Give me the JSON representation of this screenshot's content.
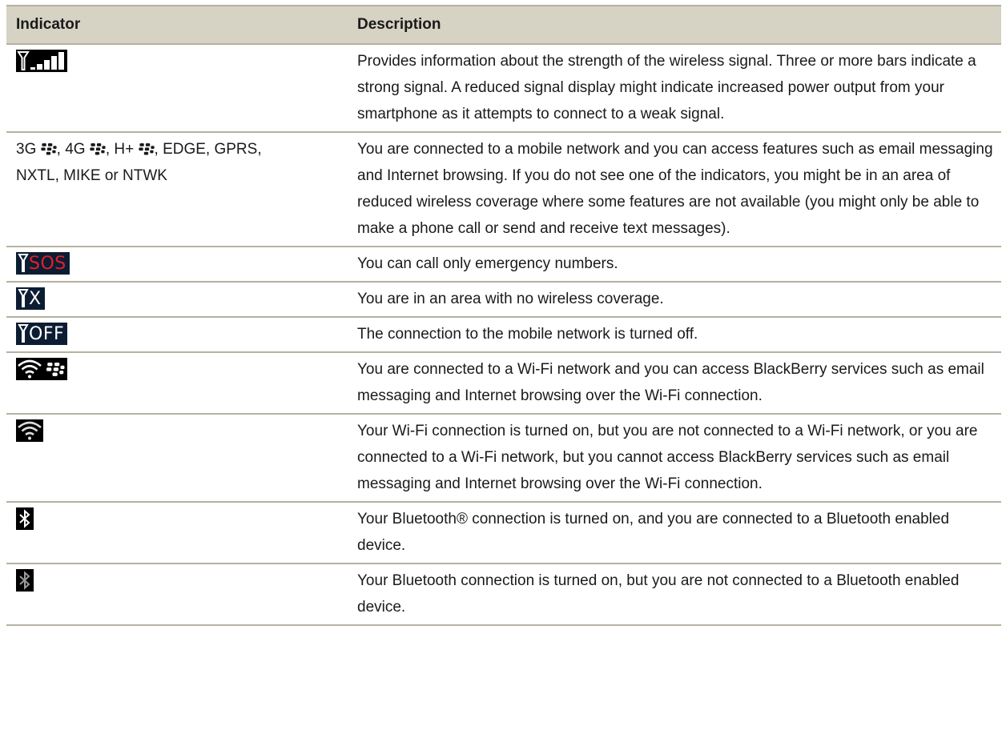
{
  "table": {
    "headers": {
      "indicator": "Indicator",
      "description": "Description"
    },
    "rows": [
      {
        "icon": "signal-strength-icon",
        "description": "Provides information about the strength of the wireless signal. Three or more bars indicate a strong signal. A reduced signal display might indicate increased power output from your smartphone as it attempts to connect to a weak signal."
      },
      {
        "indicator_text": {
          "g3": "3G",
          "g4": "4G",
          "hplus": "H+",
          "rest_line1": ", EDGE, GPRS,",
          "rest_line2": "NXTL, MIKE or NTWK"
        },
        "description": "You are connected to a mobile network and you can access features such as email messaging and Internet browsing. If you do not see one of the indicators, you might be in an area of reduced wireless coverage where some features are not available (you might only be able to make a phone call or send and receive text messages)."
      },
      {
        "icon": "sos-signal-icon",
        "icon_text": "SOS",
        "icon_text_color": "#e0202a",
        "description": "You can call only emergency numbers."
      },
      {
        "icon": "no-coverage-icon",
        "icon_text": "X",
        "icon_text_color": "#ffffff",
        "description": "You are in an area with no wireless coverage."
      },
      {
        "icon": "network-off-icon",
        "icon_text": "OFF",
        "icon_text_color": "#ffffff",
        "description": "The connection to the mobile network is turned off."
      },
      {
        "icon": "wifi-blackberry-icon",
        "description": "You are connected to a Wi-Fi network and you can access BlackBerry services such as email messaging and Internet browsing over the Wi-Fi connection."
      },
      {
        "icon": "wifi-icon",
        "description": "Your Wi-Fi connection is turned on, but you are not connected to a Wi-Fi network, or you are connected to a Wi-Fi network, but you cannot access BlackBerry services such as email messaging and Internet browsing over the Wi-Fi connection."
      },
      {
        "icon": "bluetooth-connected-icon",
        "description": "Your Bluetooth® connection is turned on, and you are connected to a Bluetooth enabled device."
      },
      {
        "icon": "bluetooth-on-icon",
        "description": "Your Bluetooth connection is turned on, but you are not connected to a Bluetooth enabled device."
      }
    ]
  },
  "colors": {
    "header_bg": "#d6d2c4",
    "rule": "#b6b1a0",
    "icon_bg_navy": "#0c1d33",
    "icon_bg_black": "#000000"
  }
}
